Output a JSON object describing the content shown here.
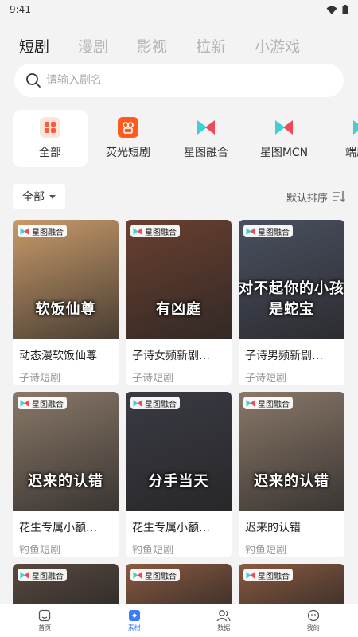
{
  "status": {
    "time": "9:41"
  },
  "top_tabs": [
    {
      "label": "短剧",
      "active": true
    },
    {
      "label": "漫剧",
      "active": false
    },
    {
      "label": "影视",
      "active": false
    },
    {
      "label": "拉新",
      "active": false
    },
    {
      "label": "小游戏",
      "active": false
    }
  ],
  "search": {
    "placeholder": "请输入剧名",
    "value": ""
  },
  "categories": [
    {
      "label": "全部",
      "icon": "grid-icon",
      "active": true
    },
    {
      "label": "荧光短剧",
      "icon": "yingguang-logo-icon",
      "active": false
    },
    {
      "label": "星图融合",
      "icon": "xingtu-logo-icon",
      "active": false
    },
    {
      "label": "星图MCN",
      "icon": "xingtu-logo-icon",
      "active": false
    },
    {
      "label": "端原生",
      "icon": "xingtu-logo-icon",
      "active": false
    }
  ],
  "filter": {
    "label": "全部",
    "sort_label": "默认排序"
  },
  "cards": [
    {
      "tag": "星图融合",
      "poster_text": "软饭仙尊",
      "title": "动态漫软饭仙尊",
      "source": "子诗短剧",
      "bg": "#c89a6a"
    },
    {
      "tag": "星图融合",
      "poster_text": "有凶庭",
      "title": "子诗女频新剧…",
      "source": "子诗短剧",
      "bg": "#6a4030"
    },
    {
      "tag": "星图融合",
      "poster_text": "对不起你的小孩是蛇宝",
      "title": "子诗男频新剧…",
      "source": "子诗短剧",
      "bg": "#4a5060"
    },
    {
      "tag": "星图融合",
      "poster_text": "迟来的认错",
      "title": "花生专属小额…",
      "source": "钓鱼短剧",
      "bg": "#8a7868"
    },
    {
      "tag": "星图融合",
      "poster_text": "分手当天",
      "title": "花生专属小额…",
      "source": "钓鱼短剧",
      "bg": "#3a3a44"
    },
    {
      "tag": "星图融合",
      "poster_text": "迟来的认错",
      "title": "迟来的认错",
      "source": "钓鱼短剧",
      "bg": "#8a7868"
    },
    {
      "tag": "星图融合",
      "poster_text": "",
      "title": "",
      "source": "",
      "bg": "#5a4a40"
    },
    {
      "tag": "星图融合",
      "poster_text": "",
      "title": "",
      "source": "",
      "bg": "#8a5a40"
    },
    {
      "tag": "星图融合",
      "poster_text": "",
      "title": "",
      "source": "",
      "bg": "#8a5a40"
    }
  ],
  "bottom_nav": [
    {
      "label": "首页",
      "icon": "home-icon",
      "active": false
    },
    {
      "label": "素材",
      "icon": "material-icon",
      "active": true
    },
    {
      "label": "数据",
      "icon": "users-icon",
      "active": false
    },
    {
      "label": "我的",
      "icon": "profile-icon",
      "active": false
    }
  ],
  "colors": {
    "accent": "#3d7bf7",
    "yingguang": "#ff5a1f",
    "xingtu_red": "#f04a5a",
    "xingtu_cyan": "#3fd0d4"
  }
}
